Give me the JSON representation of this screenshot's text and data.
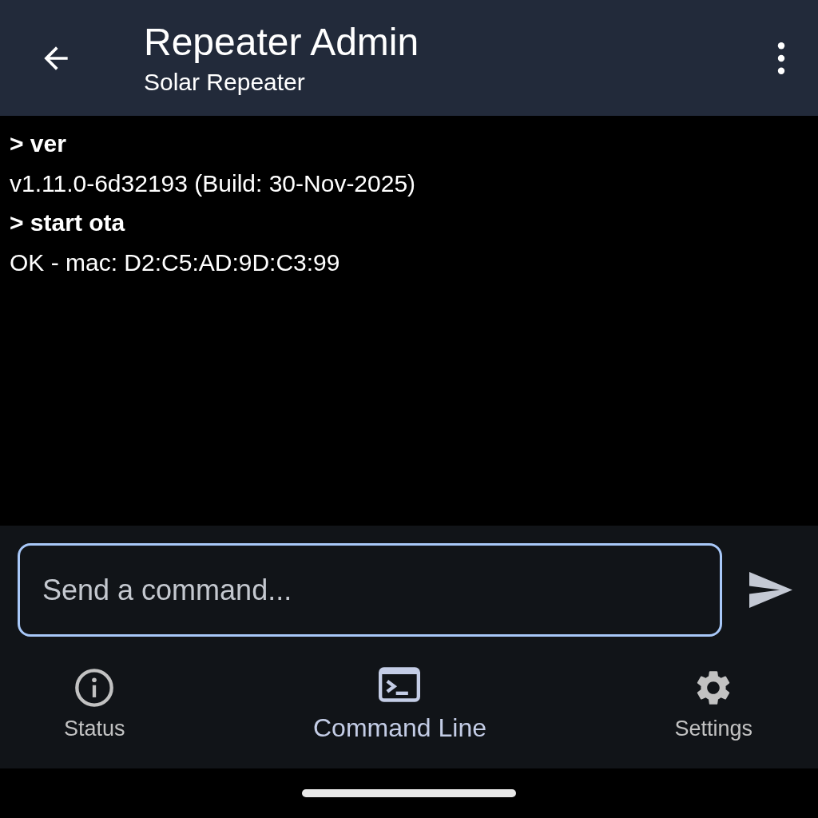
{
  "app_bar": {
    "title": "Repeater Admin",
    "subtitle": "Solar Repeater"
  },
  "console": [
    {
      "kind": "command",
      "text": "> ver"
    },
    {
      "kind": "output",
      "text": "v1.11.0-6d32193 (Build: 30-Nov-2025)"
    },
    {
      "kind": "command",
      "text": "> start ota"
    },
    {
      "kind": "output",
      "text": "OK - mac: D2:C5:AD:9D:C3:99"
    }
  ],
  "command_input": {
    "placeholder": "Send a command..."
  },
  "nav": [
    {
      "kind": "info",
      "label": "Status",
      "selected": false
    },
    {
      "kind": "terminal",
      "label": "Command Line",
      "selected": true
    },
    {
      "kind": "gear",
      "label": "Settings",
      "selected": false
    }
  ]
}
